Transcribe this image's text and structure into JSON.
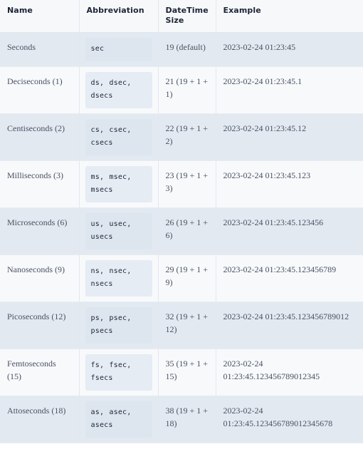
{
  "table": {
    "columns": [
      {
        "key": "name",
        "label": "Name"
      },
      {
        "key": "abbreviation",
        "label": "Abbreviation"
      },
      {
        "key": "datetime_size",
        "label": "DateTime Size"
      },
      {
        "key": "example",
        "label": "Example"
      }
    ],
    "rows": [
      {
        "name": "Seconds",
        "abbreviation": "sec",
        "datetime_size": "19 (default)",
        "example": "2023-02-24 01:23:45"
      },
      {
        "name": "Deciseconds (1)",
        "abbreviation": "ds, dsec, dsecs",
        "datetime_size": "21 (19 + 1 + 1)",
        "example": "2023-02-24 01:23:45.1"
      },
      {
        "name": "Centiseconds (2)",
        "abbreviation": "cs, csec, csecs",
        "datetime_size": "22 (19 + 1 + 2)",
        "example": "2023-02-24 01:23:45.12"
      },
      {
        "name": "Milliseconds (3)",
        "abbreviation": "ms, msec, msecs",
        "datetime_size": "23 (19 + 1 + 3)",
        "example": "2023-02-24 01:23:45.123"
      },
      {
        "name": "Microseconds (6)",
        "abbreviation": "us, usec, usecs",
        "datetime_size": "26 (19 + 1 + 6)",
        "example": "2023-02-24 01:23:45.123456"
      },
      {
        "name": "Nanoseconds (9)",
        "abbreviation": "ns, nsec, nsecs",
        "datetime_size": "29 (19 + 1 + 9)",
        "example": "2023-02-24 01:23:45.123456789"
      },
      {
        "name": "Picoseconds (12)",
        "abbreviation": "ps, psec, psecs",
        "datetime_size": "32 (19 + 1 + 12)",
        "example": "2023-02-24 01:23:45.123456789012"
      },
      {
        "name": "Femtoseconds (15)",
        "abbreviation": "fs, fsec, fsecs",
        "datetime_size": "35 (19 + 1 + 15)",
        "example": "2023-02-24 01:23:45.123456789012345"
      },
      {
        "name": "Attoseconds (18)",
        "abbreviation": "as, asec, asecs",
        "datetime_size": "38 (19 + 1 + 18)",
        "example": "2023-02-24 01:23:45.123456789012345678"
      }
    ]
  },
  "colors": {
    "header_bg": "#f7f8fa",
    "header_text": "#1c2536",
    "row_odd_bg": "#e2e9f1",
    "row_even_bg": "#f7f9fb",
    "cell_text": "#4a5262",
    "code_bg": "#dde5ef",
    "code_text": "#1c2536",
    "border": "#e3e8ef"
  }
}
